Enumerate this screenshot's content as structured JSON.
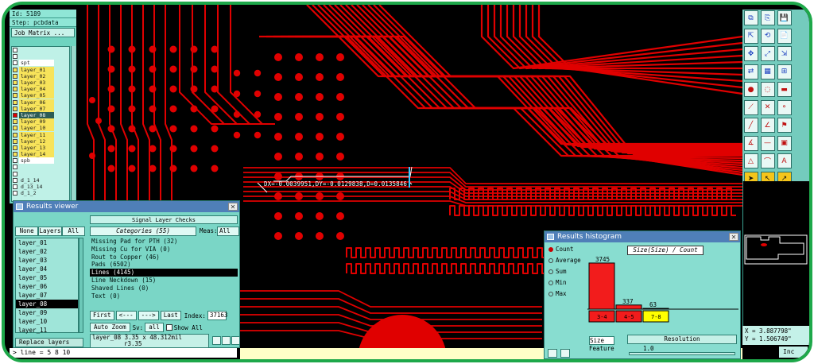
{
  "left_panel": {
    "rows": [
      "Id: 5189",
      "Step: pcbdata",
      "Job Matrix ..."
    ],
    "layers": [
      {
        "label": "",
        "swatch": "#ffffff",
        "kind": "white"
      },
      {
        "label": "",
        "swatch": "#ffffff",
        "kind": "white"
      },
      {
        "label": "spt",
        "swatch": "#ffffff",
        "kind": "white"
      },
      {
        "label": "layer_01",
        "swatch": "#f7e35a",
        "kind": "sig"
      },
      {
        "label": "layer_02",
        "swatch": "#f7e35a",
        "kind": "sig"
      },
      {
        "label": "layer_03",
        "swatch": "#f7e35a",
        "kind": "sig"
      },
      {
        "label": "layer_04",
        "swatch": "#f7e35a",
        "kind": "sig"
      },
      {
        "label": "layer_05",
        "swatch": "#f7e35a",
        "kind": "sig"
      },
      {
        "label": "layer_06",
        "swatch": "#f7e35a",
        "kind": "sig"
      },
      {
        "label": "layer_07",
        "swatch": "#f7e35a",
        "kind": "sig"
      },
      {
        "label": "layer_08",
        "swatch": "#e00000",
        "kind": "sel"
      },
      {
        "label": "layer_09",
        "swatch": "#f7e35a",
        "kind": "sig"
      },
      {
        "label": "layer_10",
        "swatch": "#f7e35a",
        "kind": "sig"
      },
      {
        "label": "layer_11",
        "swatch": "#f7e35a",
        "kind": "sig"
      },
      {
        "label": "layer_12",
        "swatch": "#f7e35a",
        "kind": "sig"
      },
      {
        "label": "layer_13",
        "swatch": "#f7e35a",
        "kind": "sig"
      },
      {
        "label": "layer_14",
        "swatch": "#f7e35a",
        "kind": "sig"
      },
      {
        "label": "spb",
        "swatch": "#ffffff",
        "kind": "white"
      },
      {
        "label": "",
        "swatch": "#ffffff",
        "kind": "white"
      },
      {
        "label": "",
        "swatch": "#ffffff",
        "kind": "white"
      },
      {
        "label": "d_1_14",
        "swatch": "#ffffff",
        "kind": "plain"
      },
      {
        "label": "d_13_14",
        "swatch": "#ffffff",
        "kind": "plain"
      },
      {
        "label": "d_1_2",
        "swatch": "#ffffff",
        "kind": "plain"
      }
    ]
  },
  "measure": {
    "text": "DX=-0.0039951,DY=-0.0129838,D=0.0135846"
  },
  "results_viewer": {
    "title": "Results viewer",
    "header": "Signal Layer Checks",
    "filters": [
      "None",
      "Layers",
      "All"
    ],
    "categories_button": "Categories (55)",
    "meas_label": "Meas:",
    "meas_value": "All",
    "layers": [
      "layer_01",
      "layer_02",
      "layer_03",
      "layer_04",
      "layer_05",
      "layer_06",
      "layer_07",
      "layer_08",
      "layer_09",
      "layer_10",
      "layer_11"
    ],
    "selected_layer": "layer_08",
    "categories": [
      "Missing Pad for PTH (32)",
      "Missing Cu for VIA (0)",
      "Rout to Copper (46)",
      "Pads (6502)",
      "Lines (4145)",
      "Line Neckdown (15)",
      "Shaved Lines (0)",
      "Text (0)"
    ],
    "selected_category": "Lines (4145)",
    "nav": {
      "first": "First",
      "prev": "<---",
      "next": "--->",
      "last": "Last",
      "index_label": "Index:",
      "index_value": "37163"
    },
    "zoom": "Auto Zoom",
    "sv_label": "Sv:",
    "sv_value": "all",
    "show_all": "Show All",
    "status_line1": "layer_08 3.35 x 48.312mil",
    "status_line2": "r3.35",
    "replace": "Replace layers"
  },
  "command_line": "> line = 5 8 10",
  "histogram": {
    "title": "Results histogram",
    "label": "Size(Size) / Count",
    "modes": [
      "Count",
      "Average",
      "Sum",
      "Min",
      "Max"
    ],
    "selected_mode": "Count",
    "size_label": "Size",
    "feature_label": "Feature",
    "resolution_label": "Resolution",
    "slider_value": "1.0",
    "colors": {
      "bar": "#f21c1c",
      "outline": "#000000",
      "highlight": "#ffff00"
    }
  },
  "chart_data": {
    "type": "bar",
    "categories": [
      "3-4",
      "4-5",
      "7-8"
    ],
    "values": [
      3745,
      337,
      63
    ],
    "title": "Size(Size) / Count",
    "xlabel": "",
    "ylabel": "",
    "ylim": [
      0,
      4000
    ]
  },
  "coords": {
    "x": "X = 3.887798\"",
    "y": "Y = 1.506749\""
  },
  "coords_tab": "Inc",
  "toolbar_icons": [
    [
      "copy-icon",
      "paste-icon",
      "save-icon"
    ],
    [
      "move-icon",
      "restore-icon",
      "page-icon"
    ],
    [
      "pan-icon",
      "zoom-fit-icon",
      "scale-icon"
    ],
    [
      "arrows-icon",
      "layer-icon",
      "grid-icon"
    ],
    [
      "point-icon",
      "snap-icon",
      "ruler-icon"
    ],
    [
      "edge-icon",
      "cross-icon",
      "node-icon"
    ],
    [
      "line-icon",
      "slope-icon",
      "flag-icon"
    ],
    [
      "angle-icon",
      "dash-icon",
      "pad-icon"
    ],
    [
      "triangle-icon",
      "arc-icon",
      "text-icon"
    ],
    [
      "pointer-icon",
      "select-icon",
      "select2-icon"
    ]
  ],
  "colors": {
    "trace": "#e00000",
    "board": "#000000",
    "panel": "#6fd4c0",
    "title_bar": "#4f7fb8",
    "frame": "#1ea84a"
  }
}
